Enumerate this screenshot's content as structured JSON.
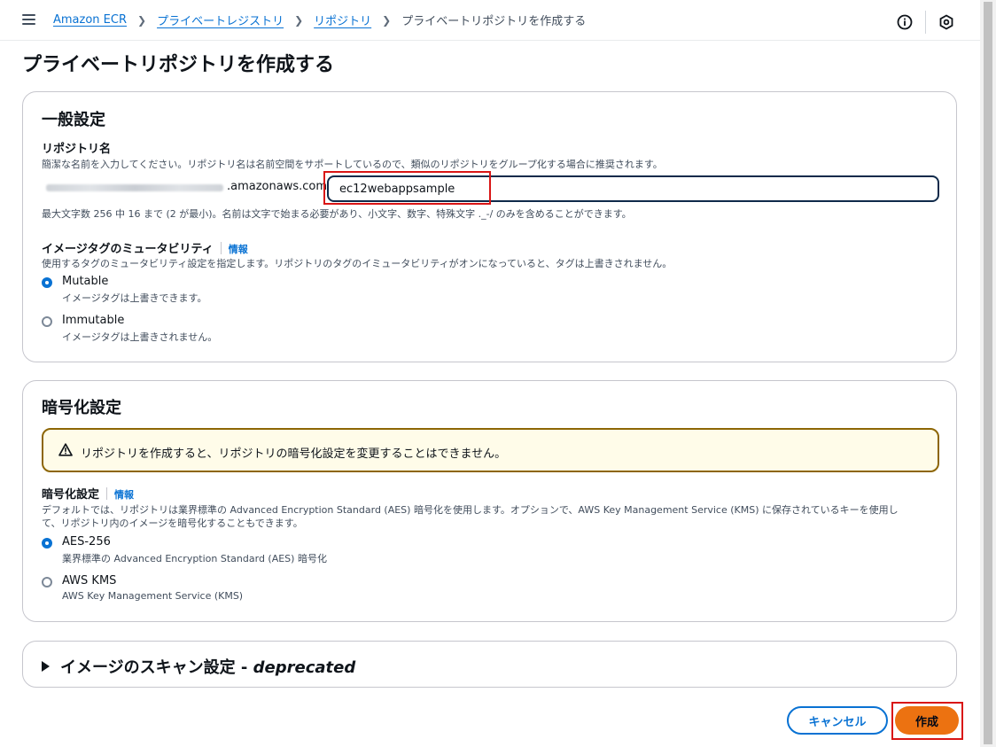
{
  "breadcrumb": {
    "items": [
      "Amazon ECR",
      "プライベートレジストリ",
      "リポジトリ"
    ],
    "current": "プライベートリポジトリを作成する"
  },
  "page": {
    "title": "プライベートリポジトリを作成する"
  },
  "general": {
    "title": "一般設定",
    "repo_name": {
      "label": "リポジトリ名",
      "description": "簡潔な名前を入力してください。リポジトリ名は名前空間をサポートしているので、類似のリポジトリをグループ化する場合に推奨されます。",
      "prefix_suffix": ".amazonaws.com/",
      "value": "ec12webappsample",
      "constraint": "最大文字数 256 中 16 まで (2 が最小)。名前は文字で始まる必要があり、小文字、数字、特殊文字 ._-/ のみを含めることができます。"
    },
    "mutability": {
      "label": "イメージタグのミュータビリティ",
      "info": "情報",
      "description": "使用するタグのミュータビリティ設定を指定します。リポジトリのタグのイミュータビリティがオンになっていると、タグは上書きされません。",
      "options": [
        {
          "label": "Mutable",
          "desc": "イメージタグは上書きできます。",
          "checked": true
        },
        {
          "label": "Immutable",
          "desc": "イメージタグは上書きされません。",
          "checked": false
        }
      ]
    }
  },
  "encryption": {
    "title": "暗号化設定",
    "alert": "リポジトリを作成すると、リポジトリの暗号化設定を変更することはできません。",
    "label": "暗号化設定",
    "info": "情報",
    "description_line1": "デフォルトでは、リポジトリは業界標準の Advanced Encryption Standard (AES) 暗号化を使用します。オプションで、AWS Key Management Service (KMS) に保存されているキーを使用し",
    "description_line2": "て、リポジトリ内のイメージを暗号化することもできます。",
    "options": [
      {
        "label": "AES-256",
        "desc": "業界標準の Advanced Encryption Standard (AES) 暗号化",
        "checked": true
      },
      {
        "label": "AWS KMS",
        "desc": "AWS Key Management Service (KMS)",
        "checked": false
      }
    ]
  },
  "scan": {
    "title": "イメージのスキャン設定 - ",
    "title_em": "deprecated"
  },
  "actions": {
    "cancel": "キャンセル",
    "create": "作成"
  }
}
